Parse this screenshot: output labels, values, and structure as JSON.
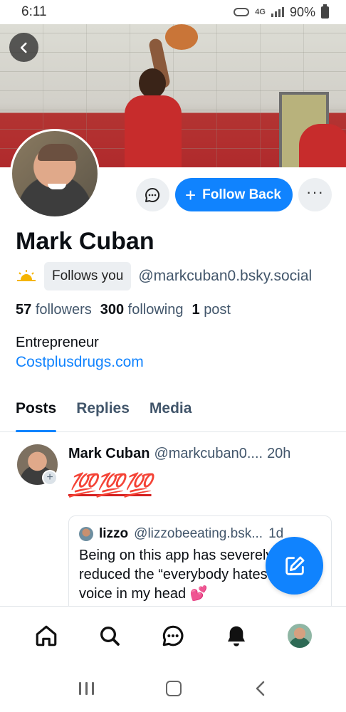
{
  "status_bar": {
    "time": "6:11",
    "network": "4G",
    "battery": "90%"
  },
  "profile": {
    "name": "Mark Cuban",
    "follows_you_label": "Follows you",
    "handle": "@markcuban0.bsky.social",
    "followers_count": "57",
    "followers_label": "followers",
    "following_count": "300",
    "following_label": "following",
    "posts_count": "1",
    "posts_label": "post",
    "bio": "Entrepreneur",
    "link": "Costplusdrugs.com"
  },
  "actions": {
    "follow_back_label": "Follow Back",
    "more_label": "···"
  },
  "tabs": [
    {
      "label": "Posts",
      "active": true
    },
    {
      "label": "Replies",
      "active": false
    },
    {
      "label": "Media",
      "active": false
    }
  ],
  "post": {
    "author": "Mark Cuban",
    "handle": "@markcuban0....",
    "time": "20h",
    "content": "💯💯💯",
    "quote": {
      "author": "lizzo",
      "handle": "@lizzobeeating.bsk...",
      "time": "1d",
      "text": "Being on this app has severely reduced the “everybody hates you” voice in my head 💕"
    }
  },
  "colors": {
    "accent": "#1083fe",
    "muted": "#42566b"
  },
  "icons": {
    "back": "chevron-left-icon",
    "message": "chat-bubble-icon",
    "compose": "pencil-square-icon",
    "nav": [
      "home-icon",
      "search-icon",
      "chat-icon",
      "bell-icon",
      "avatar"
    ]
  }
}
